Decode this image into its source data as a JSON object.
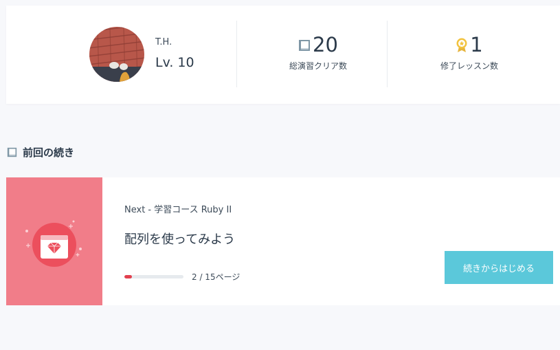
{
  "profile": {
    "name": "T.H.",
    "level": "Lv. 10",
    "avatar_icon": "user-photo"
  },
  "stats": [
    {
      "value": "20",
      "label": "総演習クリア数",
      "icon": "book-icon"
    },
    {
      "value": "1",
      "label": "修了レッスン数",
      "icon": "medal-icon"
    }
  ],
  "section": {
    "title": "前回の続き",
    "icon": "book-icon"
  },
  "continue": {
    "course": "Next - 学習コース Ruby II",
    "lesson": "配列を使ってみよう",
    "progress": {
      "current": 2,
      "total": 15,
      "fraction": 0.133,
      "text": "2 / 15ページ"
    },
    "button_label": "続きからはじめる",
    "thumbnail_icon": "ruby-gem-icon"
  },
  "colors": {
    "accent": "#5bc8da",
    "progress_fill": "#e2404f",
    "thumbnail_bg": "#f17d89",
    "text": "#2b3a4a"
  }
}
